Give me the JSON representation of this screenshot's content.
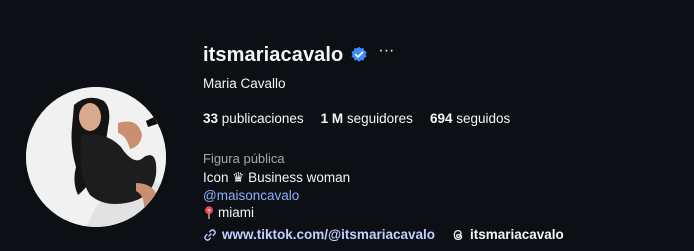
{
  "profile": {
    "username": "itsmariacavalo",
    "full_name": "Maria Cavallo",
    "stats": {
      "posts_count": "33",
      "posts_label": "publicaciones",
      "followers_count": "1 M",
      "followers_label": "seguidores",
      "following_count": "694",
      "following_label": "seguidos"
    },
    "category": "Figura pública",
    "bio": {
      "line1": "Icon ♛ Business woman",
      "mention": "@maisoncavalo",
      "location": "miami"
    },
    "link": "www.tiktok.com/@itsmariacavalo",
    "threads_handle": "itsmariacavalo"
  },
  "colors": {
    "background": "#0c0f14",
    "verified": "#3d8bfd",
    "mention": "#8faeff",
    "link": "#c0d0ff"
  },
  "icons": {
    "verified": "verified-badge-icon",
    "more": "more-options-icon",
    "location": "location-pin-icon",
    "link": "link-icon",
    "threads": "threads-icon"
  }
}
